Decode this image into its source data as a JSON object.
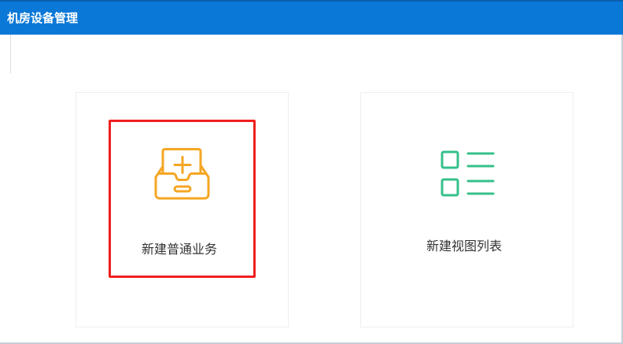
{
  "window": {
    "title": "机房设备管理"
  },
  "cards": {
    "new_business": {
      "label": "新建普通业务",
      "icon": "inbox-plus-icon",
      "color": "#f5a623",
      "highlighted": true
    },
    "new_view_list": {
      "label": "新建视图列表",
      "icon": "list-icon",
      "color": "#36c08b"
    }
  },
  "colors": {
    "titlebar": "#0a78d7",
    "highlight": "#f11f1f"
  }
}
